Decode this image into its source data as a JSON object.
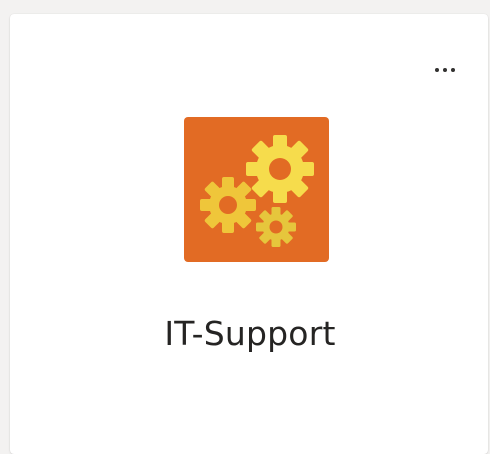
{
  "team_card": {
    "name": "IT-Support",
    "icon": "gears-icon",
    "more_options_icon": "ellipsis-icon",
    "colors": {
      "icon_background": "#E26B24",
      "gear_primary": "#F6DC4C",
      "gear_secondary": "#EFC63A",
      "gear_small": "#E6C63C"
    }
  }
}
